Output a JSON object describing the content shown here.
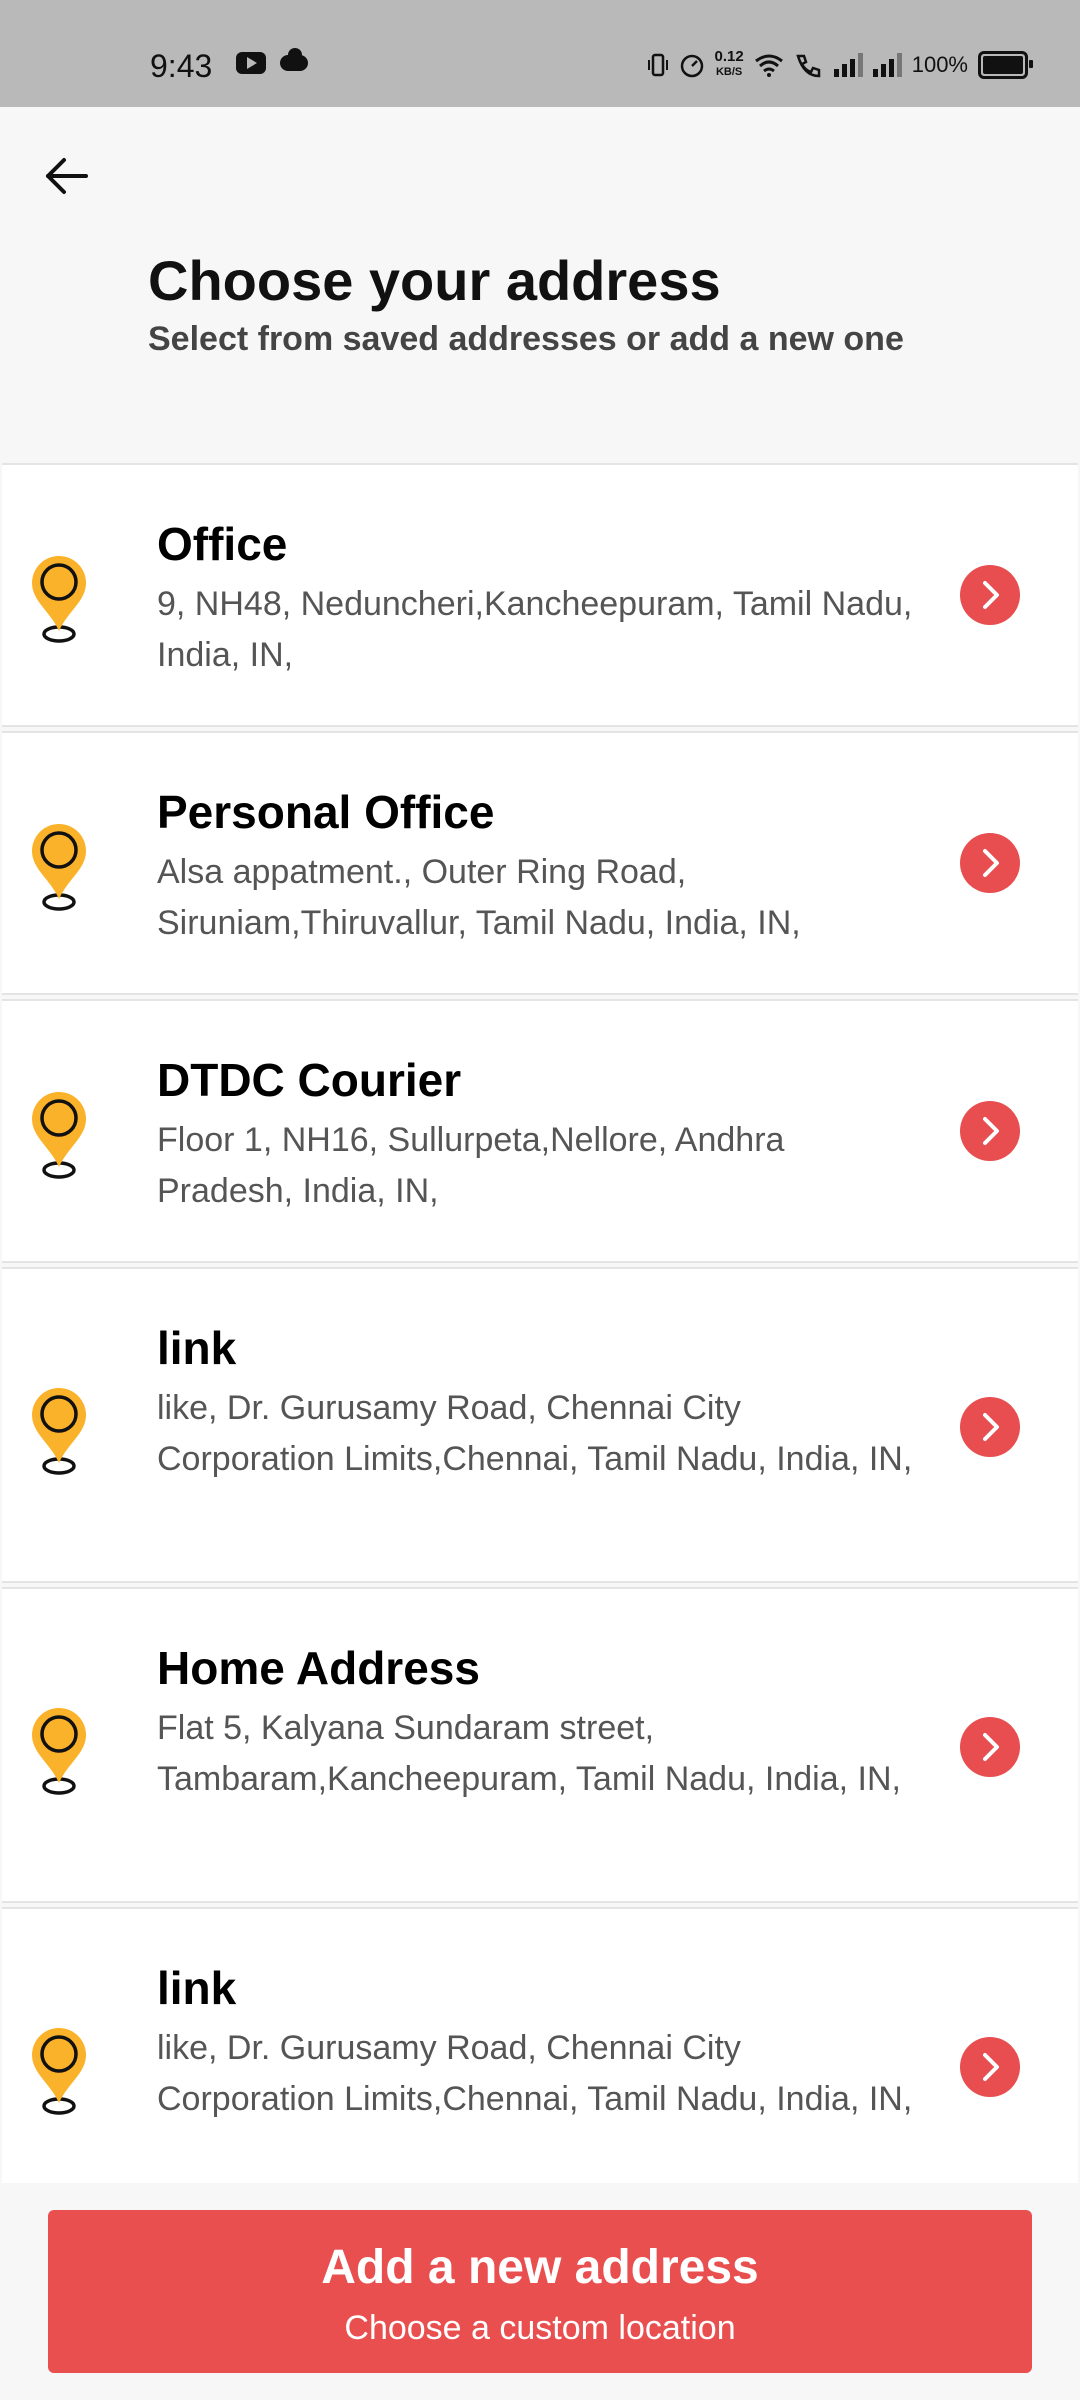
{
  "status_bar": {
    "time": "9:43",
    "net_speed_value": "0.12",
    "net_speed_unit": "KB/S",
    "battery": "100%",
    "icons": [
      "youtube-icon",
      "cloud-icon",
      "vibrate-icon",
      "speed-icon",
      "wifi-icon",
      "call-icon",
      "signal-icon",
      "signal-icon",
      "battery-icon"
    ]
  },
  "header": {
    "back_icon": "arrow-left-icon",
    "title": "Choose your address",
    "subtitle": "Select from saved addresses or add a new one"
  },
  "addresses": [
    {
      "title": "Office",
      "address": "9, NH48, Neduncheri,Kancheepuram, Tamil Nadu, India, IN,"
    },
    {
      "title": "Personal Office",
      "address": "Alsa appatment., Outer Ring Road, Siruniam,Thiruvallur, Tamil Nadu, India, IN,"
    },
    {
      "title": "DTDC Courier",
      "address": "Floor 1, NH16, Sullurpeta,Nellore, Andhra Pradesh, India, IN,"
    },
    {
      "title": "link",
      "address": "like, Dr. Gurusamy Road, Chennai City Corporation Limits,Chennai, Tamil Nadu, India, IN,"
    },
    {
      "title": "Home Address",
      "address": "Flat 5, Kalyana Sundaram street, Tambaram,Kancheepuram, Tamil Nadu, India, IN,"
    },
    {
      "title": "link",
      "address": "like, Dr. Gurusamy Road, Chennai City Corporation Limits,Chennai, Tamil Nadu, India, IN,"
    }
  ],
  "add_button": {
    "title": "Add a new address",
    "subtitle": "Choose a custom location"
  },
  "colors": {
    "accent": "#ea4f50",
    "pin": "#fbb22b",
    "status_bar": "#b9b9b9"
  }
}
